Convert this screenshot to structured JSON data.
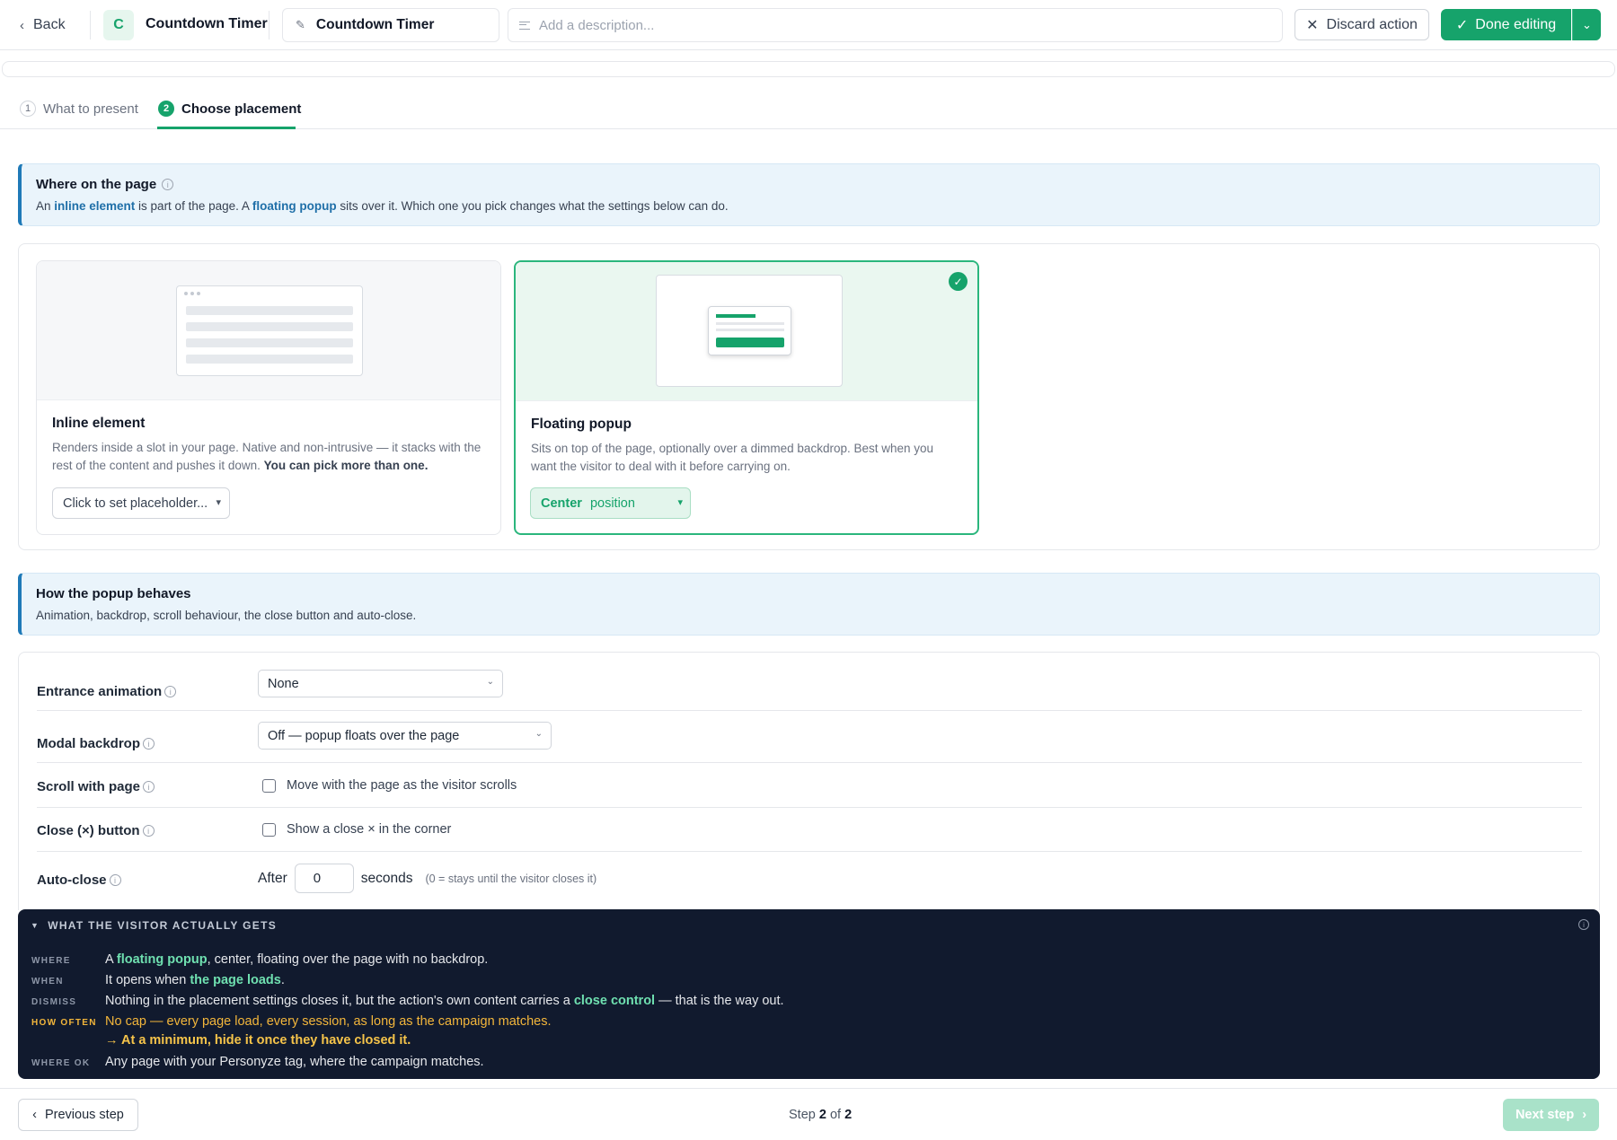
{
  "header": {
    "back_label": "Back",
    "avatar_letter": "C",
    "app_title": "Countdown Timer",
    "name_value": "Countdown Timer",
    "description_placeholder": "Add a description...",
    "discard_label": "Discard action",
    "done_label": "Done editing"
  },
  "steps": {
    "items": [
      {
        "number": "1",
        "label": "What to present",
        "active": false
      },
      {
        "number": "2",
        "label": "Choose placement",
        "active": true
      }
    ]
  },
  "placement_info": {
    "title": "Where on the page",
    "text_1": "An ",
    "hl_1": "inline element",
    "text_2": " is part of the page. A ",
    "hl_2": "floating popup",
    "text_3": " sits over it. Which one you pick changes what the settings below can do."
  },
  "placement_cards": {
    "inline": {
      "title": "Inline element",
      "desc": "Renders inside a slot in your page. Native and non-intrusive — it stacks with the rest of the content and pushes it down. ",
      "desc_bold": "You can pick more than one.",
      "select_value": "Click to set placeholder...",
      "selected": false
    },
    "floating": {
      "title": "Floating popup",
      "desc": "Sits on top of the page, optionally over a dimmed backdrop. Best when you want the visitor to deal with it before carrying on.",
      "select_value_bold": "Center",
      "select_value": "position",
      "selected": true
    }
  },
  "behaviour_info": {
    "title": "How the popup behaves",
    "text": "Animation, backdrop, scroll behaviour, the close button and auto-close."
  },
  "settings": {
    "entrance_animation": {
      "label": "Entrance animation",
      "value": "None"
    },
    "modal_backdrop": {
      "label": "Modal backdrop",
      "value": "Off — popup floats over the page"
    },
    "scroll_with_page": {
      "label": "Scroll with page",
      "checkbox_label": "Move with the page as the visitor scrolls",
      "checked": false
    },
    "close_button": {
      "label": "Close (×) button",
      "checkbox_label": "Show a close × in the corner",
      "checked": false
    },
    "auto_close": {
      "label": "Auto-close",
      "prefix": "After",
      "value": "0",
      "suffix": "seconds",
      "hint": "(0 = stays until the visitor closes it)"
    }
  },
  "summary": {
    "heading": "WHAT THE VISITOR ACTUALLY GETS",
    "where": {
      "key": "WHERE",
      "t1": "A ",
      "g1": "floating popup",
      "t2": ", center, floating over the page with no backdrop."
    },
    "when": {
      "key": "WHEN",
      "t1": "It opens when ",
      "g1": "the page loads",
      "t2": "."
    },
    "dismiss": {
      "key": "DISMISS",
      "t1": "Nothing in the placement settings closes it, but the action's own content carries a ",
      "g1": "close control",
      "t2": " — that is the way out."
    },
    "how_often": {
      "key": "HOW OFTEN",
      "text": "No cap — every page load, every session, as long as the campaign matches.",
      "advice": "→ At a minimum, hide it once they have closed it."
    },
    "where_ok": {
      "key": "WHERE OK",
      "text": "Any page with your Personyze tag, where the campaign matches."
    }
  },
  "footer": {
    "prev_label": "Previous step",
    "step_prefix": "Step",
    "step_current": "2",
    "step_of": "of",
    "step_total": "2",
    "next_label": "Next step"
  },
  "colors": {
    "accent": "#16a36b",
    "info_border": "#1f7ab8",
    "summary_bg": "#111a2e",
    "warning": "#f3b63b"
  }
}
